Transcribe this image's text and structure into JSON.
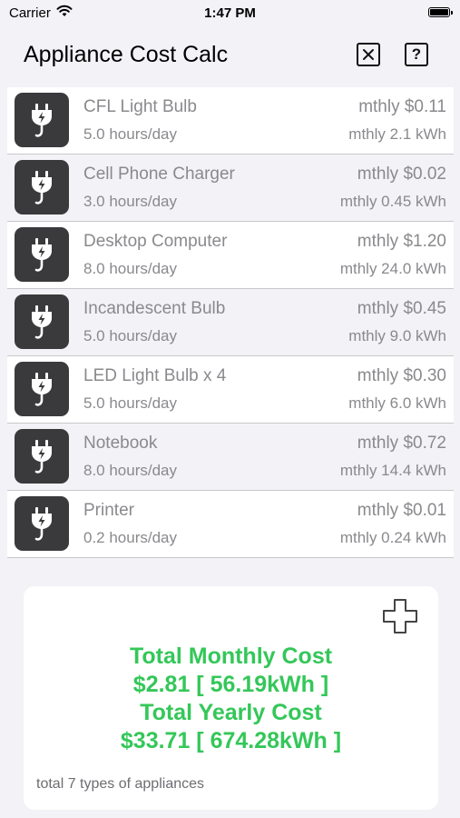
{
  "status_bar": {
    "carrier": "Carrier",
    "time": "1:47 PM"
  },
  "navbar": {
    "title": "Appliance Cost Calc",
    "close_icon": "close-box-icon",
    "help_label": "?"
  },
  "appliances": [
    {
      "name": "CFL Light Bulb",
      "hours": "5.0 hours/day",
      "cost": "mthly $0.11",
      "kwh": "mthly 2.1 kWh"
    },
    {
      "name": "Cell Phone Charger",
      "hours": "3.0 hours/day",
      "cost": "mthly $0.02",
      "kwh": "mthly 0.45 kWh"
    },
    {
      "name": "Desktop Computer",
      "hours": "8.0 hours/day",
      "cost": "mthly $1.20",
      "kwh": "mthly 24.0 kWh"
    },
    {
      "name": "Incandescent Bulb",
      "hours": "5.0 hours/day",
      "cost": "mthly $0.45",
      "kwh": "mthly 9.0 kWh"
    },
    {
      "name": "LED Light Bulb x 4",
      "hours": "5.0 hours/day",
      "cost": "mthly $0.30",
      "kwh": "mthly 6.0 kWh"
    },
    {
      "name": "Notebook",
      "hours": "8.0 hours/day",
      "cost": "mthly $0.72",
      "kwh": "mthly 14.4 kWh"
    },
    {
      "name": "Printer",
      "hours": "0.2 hours/day",
      "cost": "mthly $0.01",
      "kwh": "mthly 0.24 kWh"
    }
  ],
  "summary": {
    "monthly_label": "Total Monthly Cost",
    "monthly_value": "$2.81 [ 56.19kWh ]",
    "yearly_label": "Total Yearly Cost",
    "yearly_value": "$33.71 [ 674.28kWh ]",
    "footer": "total 7 types of appliances",
    "accent_color": "#34c759"
  }
}
